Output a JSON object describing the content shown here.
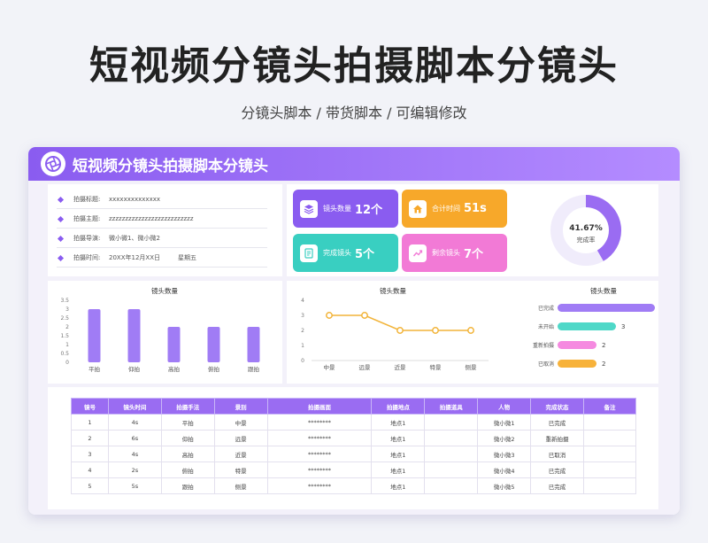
{
  "page": {
    "title": "短视频分镜头拍摄脚本分镜头",
    "subtitle": "分镜头脚本 / 带货脚本 / 可编辑修改",
    "sheet_title": "短视频分镜头拍摄脚本分镜头"
  },
  "info": [
    {
      "label": "拍摄标题:",
      "value": "xxxxxxxxxxxxxx",
      "extra": ""
    },
    {
      "label": "拍摄主题:",
      "value": "zzzzzzzzzzzzzzzzzzzzzzzzzz",
      "extra": ""
    },
    {
      "label": "拍摄导演:",
      "value": "微小微1、微小微2",
      "extra": ""
    },
    {
      "label": "拍摄时间:",
      "value": "20XX年12月XX日",
      "extra": "星期五"
    }
  ],
  "stats": [
    {
      "label": "镜头数量",
      "value": "12个",
      "color": "#8a5cf0",
      "icon": "layers-icon"
    },
    {
      "label": "合计时间",
      "value": "51s",
      "color": "#f7a82a",
      "icon": "home-icon"
    },
    {
      "label": "完成镜头",
      "value": "5个",
      "color": "#39cfc1",
      "icon": "checklist-icon"
    },
    {
      "label": "剩余镜头",
      "value": "7个",
      "color": "#f27ad6",
      "icon": "trend-icon"
    }
  ],
  "donut": {
    "value": "41.67%",
    "label": "完成率",
    "fraction": 0.4167,
    "color": "#9a6cf2",
    "track": "#f0ecfb"
  },
  "chart_data": [
    {
      "type": "bar",
      "title": "镜头数量",
      "categories": [
        "平拍",
        "仰拍",
        "高拍",
        "俯拍",
        "跟拍"
      ],
      "values": [
        3,
        3,
        2,
        2,
        2
      ],
      "ylim": [
        0,
        3.5
      ],
      "yticks": [
        "0",
        "0.5",
        "1",
        "1.5",
        "2",
        "2.5",
        "3",
        "3.5"
      ],
      "color": "#a07cf5"
    },
    {
      "type": "line",
      "title": "镜头数量",
      "categories": [
        "中景",
        "远景",
        "近景",
        "特景",
        "侧景"
      ],
      "values": [
        3,
        3,
        2,
        2,
        2
      ],
      "ylim": [
        0,
        4
      ],
      "yticks": [
        "0",
        "1",
        "2",
        "3",
        "4"
      ],
      "color": "#f2b43a"
    },
    {
      "type": "bar",
      "title": "镜头数量",
      "orientation": "horizontal",
      "categories": [
        "已完成",
        "未开始",
        "重新拍摄",
        "已取消"
      ],
      "values": [
        5,
        3,
        2,
        2
      ],
      "xlim": [
        0,
        5
      ],
      "colors": [
        "#a07cf5",
        "#4fd8c8",
        "#f58ae0",
        "#f7b23a"
      ]
    }
  ],
  "table": {
    "headers": [
      "镜号",
      "镜头时间",
      "拍摄手法",
      "景别",
      "拍摄画面",
      "拍摄地点",
      "拍摄道具",
      "人物",
      "完成状态",
      "备注"
    ],
    "rows": [
      [
        "1",
        "4s",
        "平拍",
        "中景",
        "********",
        "地点1",
        "",
        "微小微1",
        "已完成",
        ""
      ],
      [
        "2",
        "6s",
        "仰拍",
        "远景",
        "********",
        "地点1",
        "",
        "微小微2",
        "重新拍摄",
        ""
      ],
      [
        "3",
        "4s",
        "高拍",
        "近景",
        "********",
        "地点1",
        "",
        "微小微3",
        "已取消",
        ""
      ],
      [
        "4",
        "2s",
        "俯拍",
        "特景",
        "********",
        "地点1",
        "",
        "微小微4",
        "已完成",
        ""
      ],
      [
        "5",
        "5s",
        "跟拍",
        "侧景",
        "********",
        "地点1",
        "",
        "微小微5",
        "已完成",
        ""
      ]
    ]
  }
}
